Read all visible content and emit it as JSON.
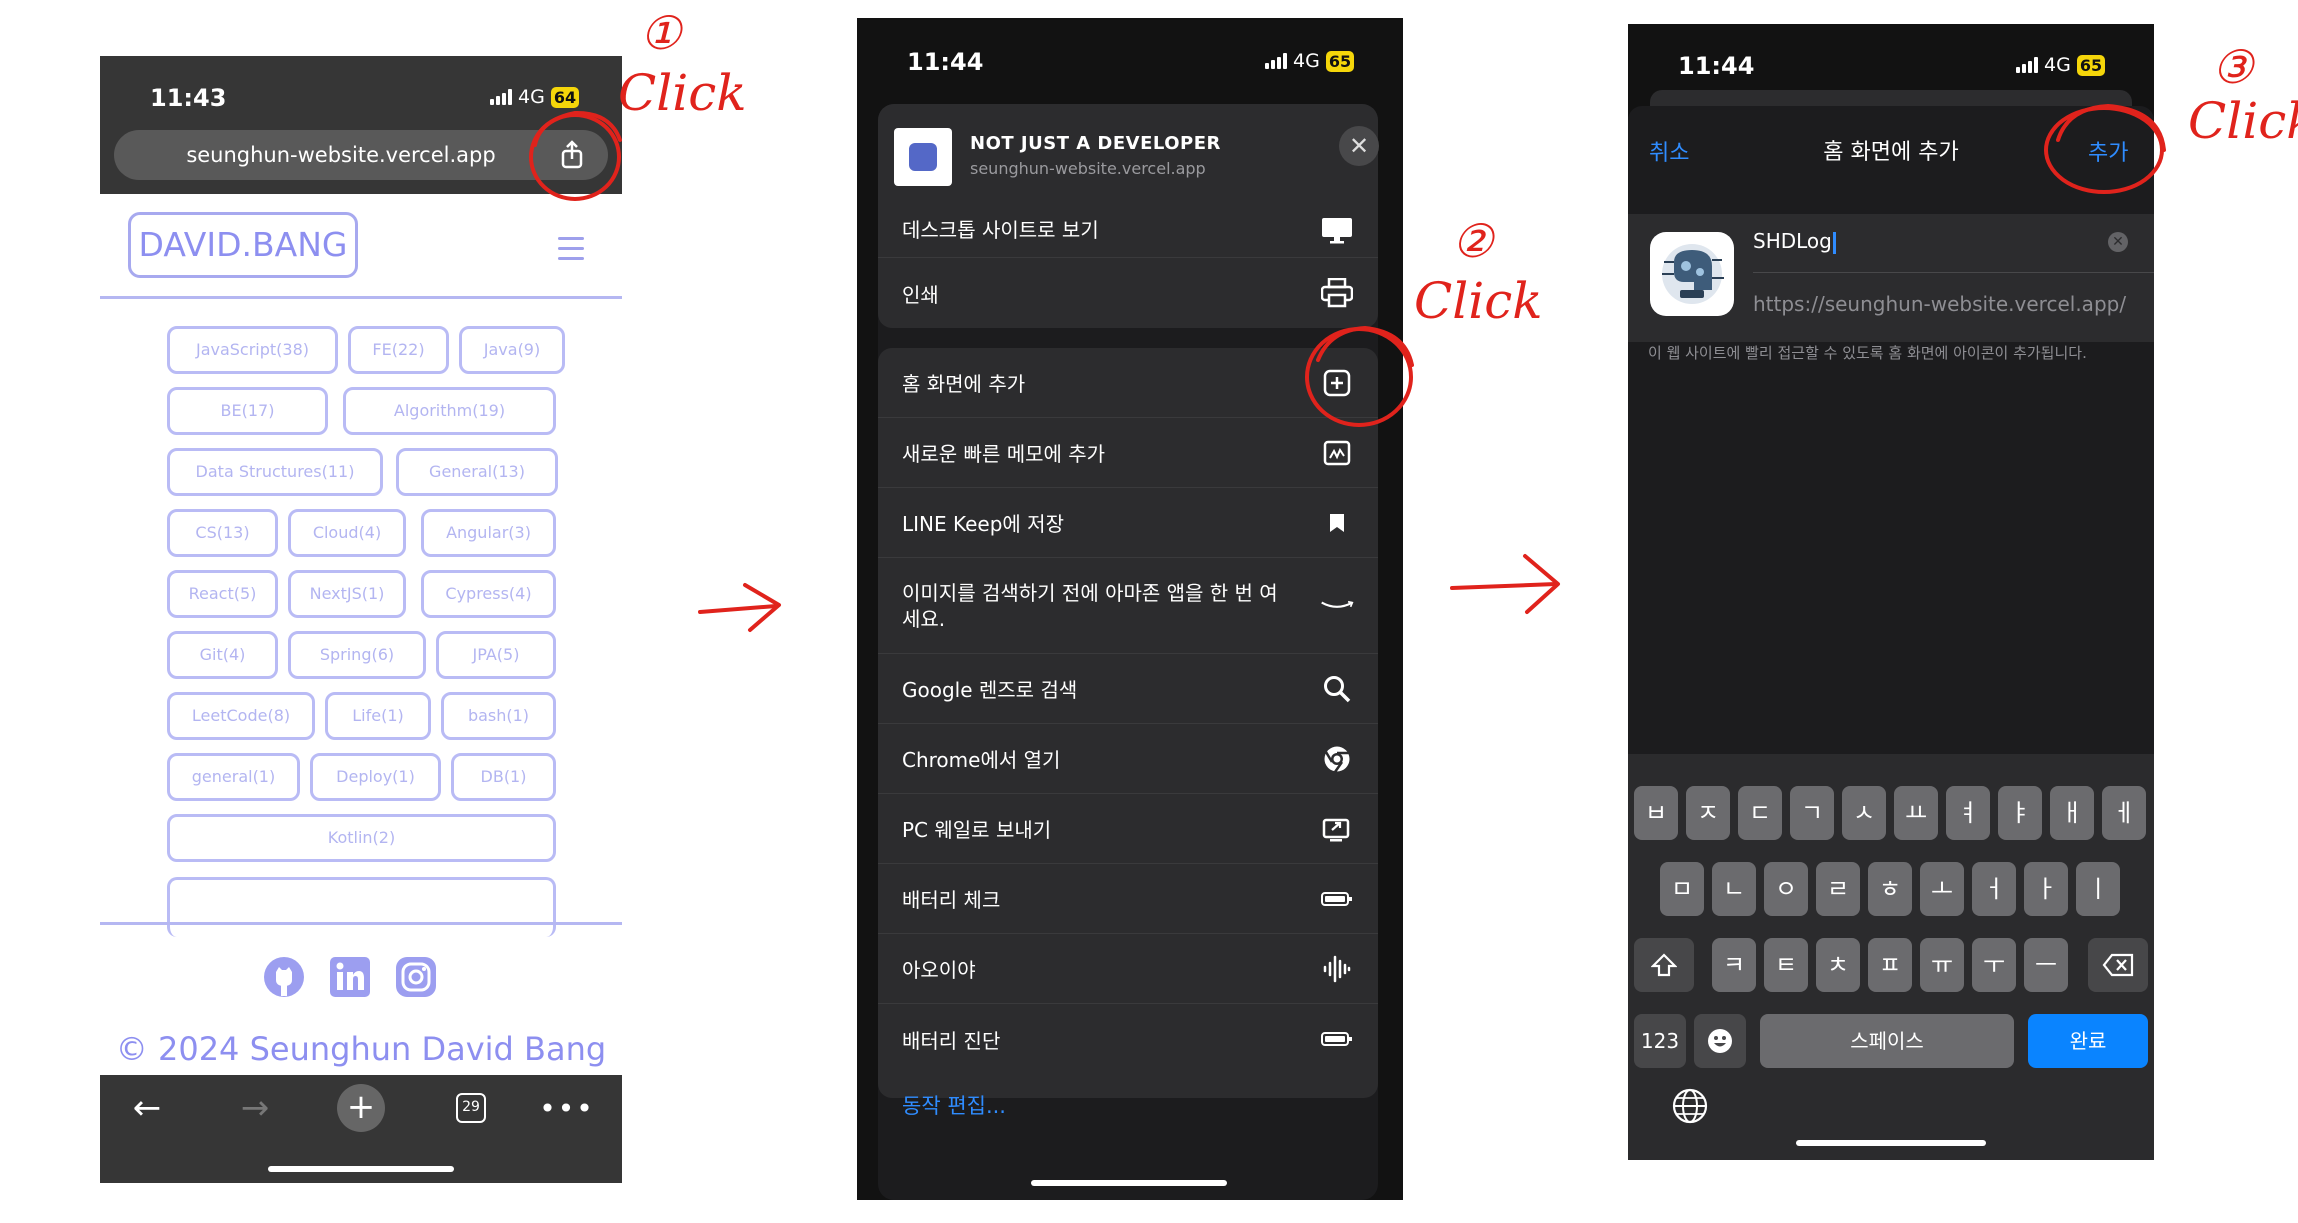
{
  "phone1": {
    "time": "11:43",
    "network": "4G",
    "battery": "64",
    "url": "seunghun-website.vercel.app",
    "brand": "DAVID.BANG",
    "tags": [
      "JavaScript(38)",
      "FE(22)",
      "Java(9)",
      "BE(17)",
      "Algorithm(19)",
      "Data Structures(11)",
      "General(13)",
      "CS(13)",
      "Cloud(4)",
      "Angular(3)",
      "React(5)",
      "NextJS(1)",
      "Cypress(4)",
      "Git(4)",
      "Spring(6)",
      "JPA(5)",
      "LeetCode(8)",
      "Life(1)",
      "bash(1)",
      "general(1)",
      "Deploy(1)",
      "DB(1)",
      "Kotlin(2)"
    ],
    "copyright": "© 2024 Seunghun David Bang",
    "tab_count": "29",
    "icons": {
      "github": "github-icon",
      "linkedin": "linkedin-icon",
      "instagram": "instagram-icon"
    }
  },
  "phone2": {
    "time": "11:44",
    "network": "4G",
    "battery": "65",
    "site_title": "NOT JUST A DEVELOPER",
    "site_url": "seunghun-website.vercel.app",
    "actions": [
      "데스크톱 사이트로 보기",
      "인쇄",
      "홈 화면에 추가",
      "새로운 빠른 메모에 추가",
      "LINE Keep에 저장",
      "이미지를 검색하기 전에 아마존 앱을 한 번 여세요.",
      "Google 렌즈로 검색",
      "Chrome에서 열기",
      "PC 웨일로 보내기",
      "배터리 체크",
      "아오이야",
      "배터리 진단"
    ],
    "edit_actions": "동작 편집..."
  },
  "phone3": {
    "time": "11:44",
    "network": "4G",
    "battery": "65",
    "cancel": "취소",
    "title": "홈 화면에 추가",
    "add": "추가",
    "name_value": "SHDLog",
    "url": "https://seunghun-website.vercel.app/",
    "note": "이 웹 사이트에 빨리 접근할 수 있도록 홈 화면에 아이콘이 추가됩니다.",
    "keyboard": {
      "row1": [
        "ㅂ",
        "ㅈ",
        "ㄷ",
        "ㄱ",
        "ㅅ",
        "ㅛ",
        "ㅕ",
        "ㅑ",
        "ㅐ",
        "ㅔ"
      ],
      "row2": [
        "ㅁ",
        "ㄴ",
        "ㅇ",
        "ㄹ",
        "ㅎ",
        "ㅗ",
        "ㅓ",
        "ㅏ",
        "ㅣ"
      ],
      "row3": [
        "ㅋ",
        "ㅌ",
        "ㅊ",
        "ㅍ",
        "ㅠ",
        "ㅜ",
        "ㅡ"
      ],
      "numbers": "123",
      "space": "스페이스",
      "done": "완료"
    }
  },
  "annotations": {
    "step1": "①",
    "step2": "②",
    "step3": "③",
    "click": "Click",
    "accent": "#e0231c"
  }
}
